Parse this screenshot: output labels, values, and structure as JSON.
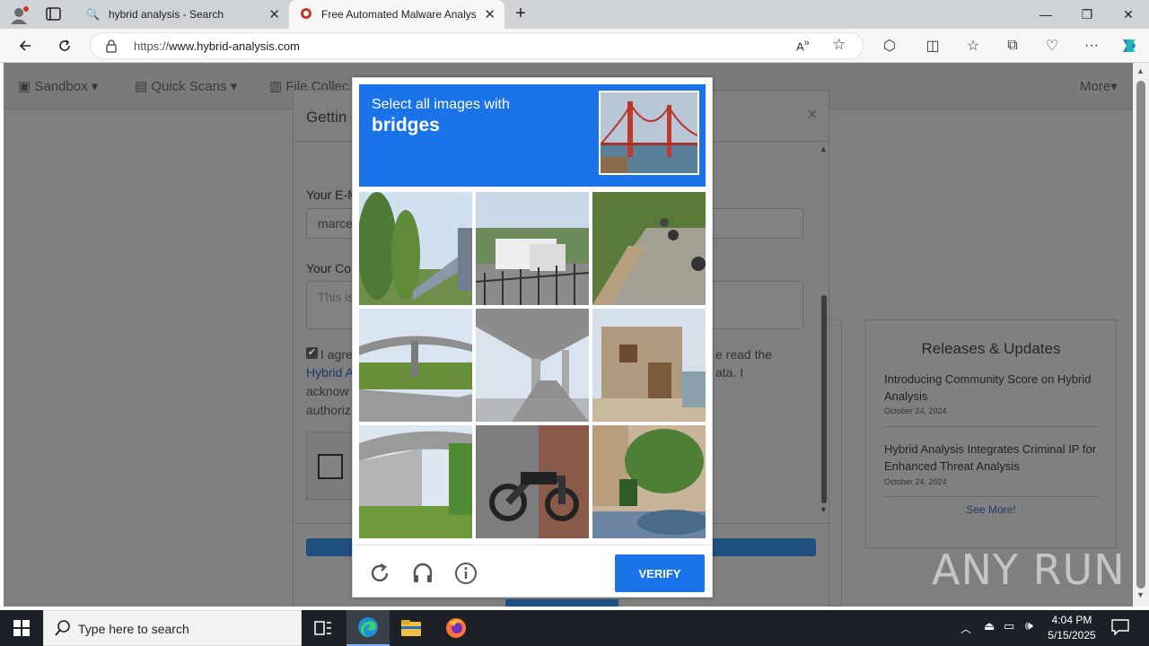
{
  "browser": {
    "tabs": [
      {
        "title": "hybrid analysis - Search"
      },
      {
        "title": "Free Automated Malware Analysis"
      }
    ],
    "url": "https://www.hybrid-analysis.com",
    "url_prefix": "https://",
    "url_host": "www.hybrid-analysis.com"
  },
  "page": {
    "nav": {
      "sandbox": "Sandbox",
      "quick_scans": "Quick Scans",
      "file_collections": "File Collec",
      "more": "More"
    },
    "modal": {
      "title": "Gettin",
      "email_label": "Your E-M",
      "email_value": "marce",
      "comment_label": "Your Co",
      "comment_placeholder": "This is",
      "agree_text": "I agre",
      "agree_line2_link": "Hybrid A",
      "agree_line3": "acknow",
      "agree_line4": "authoriz",
      "right_text1": "e read the",
      "right_text2": "ata. I"
    },
    "releases": {
      "title": "Releases & Updates",
      "items": [
        {
          "title": "Introducing Community Score on Hybrid Analysis",
          "date": "October 24, 2024"
        },
        {
          "title": "Hybrid Analysis Integrates Criminal IP for Enhanced Threat Analysis",
          "date": "October 24, 2024"
        }
      ],
      "see_more": "See More!"
    }
  },
  "captcha": {
    "prompt": "Select all images with",
    "target": "bridges",
    "verify_label": "VERIFY",
    "tiles": [
      "trees-bridge",
      "street-truck",
      "road-scooters",
      "overpass-road",
      "under-bridge",
      "house",
      "overpass-grass",
      "motorbike",
      "car-tree"
    ]
  },
  "watermark": "ANY RUN",
  "taskbar": {
    "search_placeholder": "Type here to search",
    "time": "4:04 PM",
    "date": "5/15/2025"
  }
}
